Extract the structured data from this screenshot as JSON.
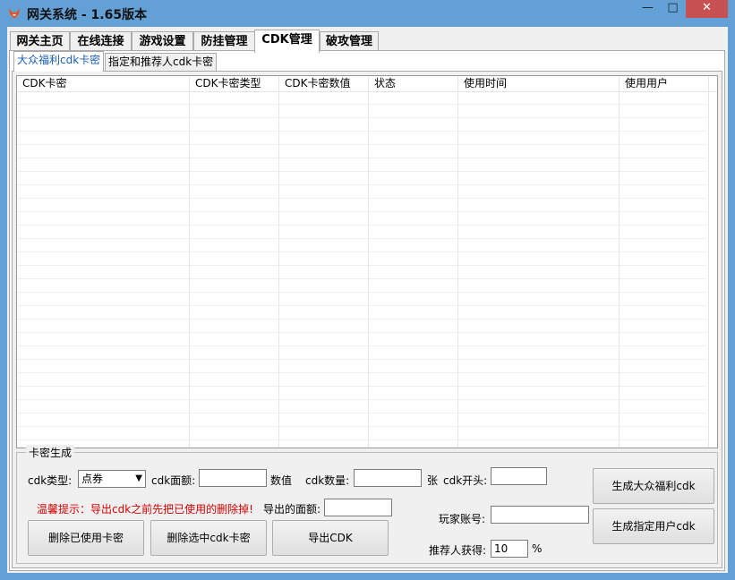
{
  "window": {
    "title": "网关系统 - 1.65版本",
    "minimize": "—",
    "maximize": "□",
    "close": "✕"
  },
  "main_tabs": [
    {
      "label": "网关主页"
    },
    {
      "label": "在线连接"
    },
    {
      "label": "游戏设置"
    },
    {
      "label": "防挂管理"
    },
    {
      "label": "CDK管理"
    },
    {
      "label": "破攻管理"
    }
  ],
  "sub_tabs": [
    {
      "label": "大众福利cdk卡密"
    },
    {
      "label": "指定和推荐人cdk卡密"
    }
  ],
  "list": {
    "columns": [
      "CDK卡密",
      "CDK卡密类型",
      "CDK卡密数值",
      "状态",
      "使用时间",
      "使用用户"
    ]
  },
  "generate": {
    "group_title": "卡密生成",
    "cdk_type_label": "cdk类型:",
    "cdk_type_value": "点券",
    "cdk_amount_label": "cdk面额:",
    "cdk_amount_value": "",
    "unit_value": "数值",
    "cdk_count_label": "cdk数量:",
    "cdk_count_value": "",
    "unit_zhang": "张",
    "cdk_prefix_label": "cdk开头:",
    "cdk_prefix_value": "",
    "warning": "温馨提示：导出cdk之前先把已使用的删除掉!",
    "export_amount_label": "导出的面额:",
    "export_amount_value": "",
    "player_account_label": "玩家账号:",
    "player_account_value": "",
    "referrer_label": "推荐人获得:",
    "referrer_value": "10",
    "percent": "%",
    "btn_delete_used": "删除已使用卡密",
    "btn_delete_selected": "删除选中cdk卡密",
    "btn_export": "导出CDK",
    "btn_gen_public": "生成大众福利cdk",
    "btn_gen_user": "生成指定用户cdk"
  }
}
